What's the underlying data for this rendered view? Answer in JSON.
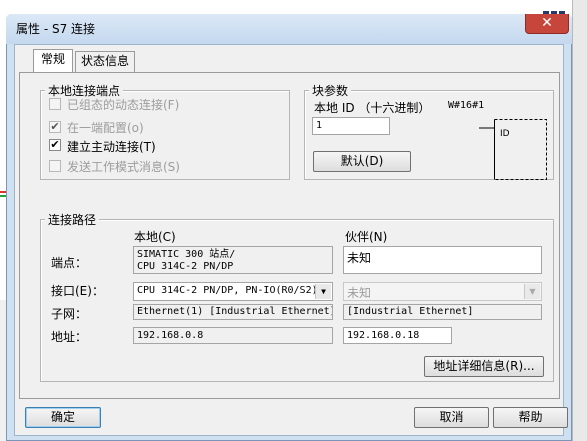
{
  "window": {
    "title": "属性 - S7 连接",
    "close_glyph": "✕"
  },
  "tabs": [
    {
      "label": "常规",
      "active": true
    },
    {
      "label": "状态信息",
      "active": false
    }
  ],
  "local_endpoint": {
    "legend": "本地连接端点",
    "options": [
      {
        "label": "已组态的动态连接(F)",
        "checked": false,
        "enabled": false
      },
      {
        "label": "在一端配置(o)",
        "checked": true,
        "enabled": false
      },
      {
        "label": "建立主动连接(T)",
        "checked": true,
        "enabled": true
      },
      {
        "label": "发送工作模式消息(S)",
        "checked": false,
        "enabled": false
      }
    ]
  },
  "block_params": {
    "legend": "块参数",
    "local_id_label": "本地 ID （十六进制）",
    "hex_value": "W#16#1",
    "id_value": "1",
    "default_button": "默认(D)",
    "diagram_label": "ID"
  },
  "connection_path": {
    "legend": "连接路径",
    "local_header": "本地(C)",
    "partner_header": "伙伴(N)",
    "endpoint_label": "端点：",
    "local_endpoint": [
      "SIMATIC 300 站点/",
      "CPU 314C-2 PN/DP"
    ],
    "partner_endpoint": "未知",
    "interface_label": "接口(E)：",
    "local_interface": "CPU 314C-2 PN/DP, PN-IO(R0/S2)",
    "partner_interface": "未知",
    "subnet_label": "子网：",
    "local_subnet": "Ethernet(1) [Industrial Ethernet]",
    "partner_subnet": "[Industrial Ethernet]",
    "address_label": "地址：",
    "local_address": "192.168.0.8",
    "partner_address": "192.168.0.18",
    "details_button": "地址详细信息(R)..."
  },
  "footer": {
    "ok": "确定",
    "cancel": "取消",
    "help": "帮助"
  }
}
